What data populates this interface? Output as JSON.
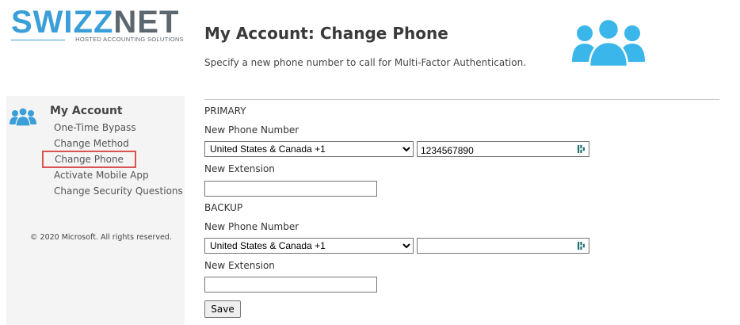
{
  "brand": {
    "logo_part1": "SWIZZ",
    "logo_part2": "NET",
    "tagline": "HOSTED ACCOUNTING SOLUTIONS",
    "primary_color": "#3a9fd8",
    "secondary_color": "#5c6770"
  },
  "header": {
    "title": "My Account: Change Phone",
    "description": "Specify a new phone number to call for Multi-Factor Authentication.",
    "icon": "users-group-icon",
    "icon_color": "#3bb6ea"
  },
  "sidebar": {
    "icon": "users-group-icon",
    "title": "My Account",
    "items": [
      {
        "label": "One-Time Bypass"
      },
      {
        "label": "Change Method"
      },
      {
        "label": "Change Phone",
        "highlighted": true,
        "highlight_color": "#d9534f"
      },
      {
        "label": "Activate Mobile App"
      },
      {
        "label": "Change Security Questions"
      }
    ],
    "copyright": "© 2020 Microsoft. All rights reserved."
  },
  "form": {
    "primary": {
      "section_label": "PRIMARY",
      "phone_label": "New Phone Number",
      "country_value": "United States & Canada +1",
      "phone_value": "1234567890",
      "extension_label": "New Extension",
      "extension_value": ""
    },
    "backup": {
      "section_label": "BACKUP",
      "phone_label": "New Phone Number",
      "country_value": "United States & Canada +1",
      "phone_value": "",
      "extension_label": "New Extension",
      "extension_value": ""
    },
    "save_label": "Save"
  }
}
